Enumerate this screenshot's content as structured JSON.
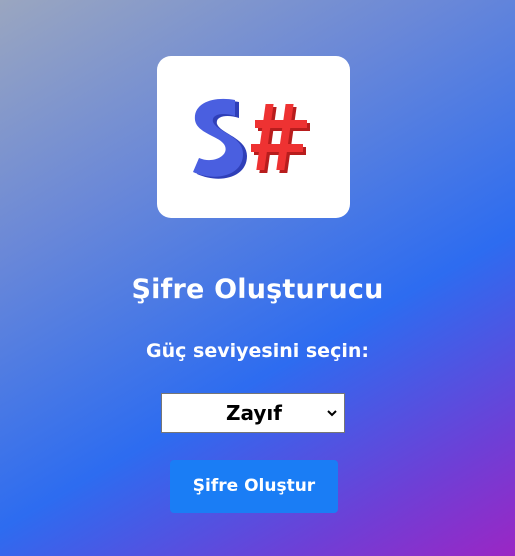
{
  "logo": {
    "icon": "s-hash-logo",
    "text": "S#"
  },
  "title": "Şifre Oluşturucu",
  "strength": {
    "label": "Güç seviyesini seçin:",
    "selected": "Zayıf"
  },
  "button": {
    "label": "Şifre Oluştur"
  },
  "colors": {
    "button": "#1a7df5",
    "logo_s": "#3a4fd0",
    "logo_hash": "#e02b2b"
  }
}
